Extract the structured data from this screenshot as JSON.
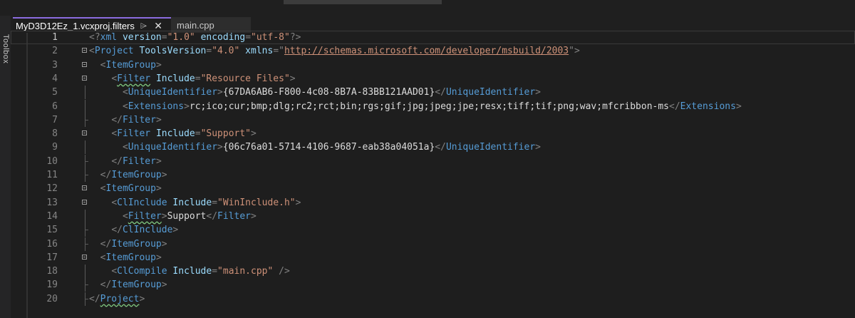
{
  "sidebar": {
    "toolbox_label": "Toolbox"
  },
  "tabs": [
    {
      "label": "MyD3D12Ez_1.vcxproj.filters",
      "active": true
    },
    {
      "label": "main.cpp",
      "active": false
    }
  ],
  "icons": {
    "pin": "pin-icon",
    "close": "close-icon",
    "fold": "collapse-icon"
  },
  "colors": {
    "tag": "#569cd6",
    "attribute": "#9cdcfe",
    "value": "#ce9178",
    "text": "#dcdcdc",
    "punctuation": "#808080",
    "line_number": "#858585",
    "active_tab_accent": "#8b6ce0"
  },
  "editor": {
    "current_line": 1,
    "lines": [
      {
        "n": "1",
        "fold": false,
        "guide": "none",
        "tokens": [
          [
            "punct",
            "<?"
          ],
          [
            "tag",
            "xml"
          ],
          [
            "text",
            " "
          ],
          [
            "attr",
            "version"
          ],
          [
            "punct",
            "="
          ],
          [
            "val",
            "\"1.0\""
          ],
          [
            "text",
            " "
          ],
          [
            "attr",
            "encoding"
          ],
          [
            "punct",
            "="
          ],
          [
            "val",
            "\"utf-8\""
          ],
          [
            "punct",
            "?>"
          ]
        ]
      },
      {
        "n": "2",
        "fold": true,
        "guide": "none",
        "tokens": [
          [
            "punct",
            "<"
          ],
          [
            "tag",
            "Project"
          ],
          [
            "text",
            " "
          ],
          [
            "attr",
            "ToolsVersion"
          ],
          [
            "punct",
            "="
          ],
          [
            "val",
            "\"4.0\""
          ],
          [
            "text",
            " "
          ],
          [
            "attr",
            "xmlns"
          ],
          [
            "punct",
            "="
          ],
          [
            "punct",
            "\""
          ],
          [
            "link",
            "http://schemas.microsoft.com/developer/msbuild/2003"
          ],
          [
            "punct",
            "\">"
          ]
        ]
      },
      {
        "n": "3",
        "fold": true,
        "guide": "none",
        "tokens": [
          [
            "text",
            "  "
          ],
          [
            "punct",
            "<"
          ],
          [
            "tag",
            "ItemGroup"
          ],
          [
            "punct",
            ">"
          ]
        ]
      },
      {
        "n": "4",
        "fold": true,
        "guide": "none",
        "tokens": [
          [
            "text",
            "    "
          ],
          [
            "punct",
            "<"
          ],
          [
            "tagsq",
            "Filter"
          ],
          [
            "text",
            " "
          ],
          [
            "attr",
            "Include"
          ],
          [
            "punct",
            "="
          ],
          [
            "val",
            "\"Resource Files\""
          ],
          [
            "punct",
            ">"
          ]
        ]
      },
      {
        "n": "5",
        "fold": false,
        "guide": "line",
        "tokens": [
          [
            "text",
            "      "
          ],
          [
            "punct",
            "<"
          ],
          [
            "tag",
            "UniqueIdentifier"
          ],
          [
            "punct",
            ">"
          ],
          [
            "text",
            "{67DA6AB6-F800-4c08-8B7A-83BB121AAD01}"
          ],
          [
            "punct",
            "</"
          ],
          [
            "tag",
            "UniqueIdentifier"
          ],
          [
            "punct",
            ">"
          ]
        ]
      },
      {
        "n": "6",
        "fold": false,
        "guide": "line",
        "tokens": [
          [
            "text",
            "      "
          ],
          [
            "punct",
            "<"
          ],
          [
            "tag",
            "Extensions"
          ],
          [
            "punct",
            ">"
          ],
          [
            "text",
            "rc;ico;cur;bmp;dlg;rc2;rct;bin;rgs;gif;jpg;jpeg;jpe;resx;tiff;tif;png;wav;mfcribbon-ms"
          ],
          [
            "punct",
            "</"
          ],
          [
            "tag",
            "Extensions"
          ],
          [
            "punct",
            ">"
          ]
        ]
      },
      {
        "n": "7",
        "fold": false,
        "guide": "end",
        "tokens": [
          [
            "text",
            "    "
          ],
          [
            "punct",
            "</"
          ],
          [
            "tag",
            "Filter"
          ],
          [
            "punct",
            ">"
          ]
        ]
      },
      {
        "n": "8",
        "fold": true,
        "guide": "none",
        "tokens": [
          [
            "text",
            "    "
          ],
          [
            "punct",
            "<"
          ],
          [
            "tag",
            "Filter"
          ],
          [
            "text",
            " "
          ],
          [
            "attr",
            "Include"
          ],
          [
            "punct",
            "="
          ],
          [
            "val",
            "\"Support\""
          ],
          [
            "punct",
            ">"
          ]
        ]
      },
      {
        "n": "9",
        "fold": false,
        "guide": "line",
        "tokens": [
          [
            "text",
            "      "
          ],
          [
            "punct",
            "<"
          ],
          [
            "tag",
            "UniqueIdentifier"
          ],
          [
            "punct",
            ">"
          ],
          [
            "text",
            "{06c76a01-5714-4106-9687-eab38a04051a}"
          ],
          [
            "punct",
            "</"
          ],
          [
            "tag",
            "UniqueIdentifier"
          ],
          [
            "punct",
            ">"
          ]
        ]
      },
      {
        "n": "10",
        "fold": false,
        "guide": "end",
        "tokens": [
          [
            "text",
            "    "
          ],
          [
            "punct",
            "</"
          ],
          [
            "tag",
            "Filter"
          ],
          [
            "punct",
            ">"
          ]
        ]
      },
      {
        "n": "11",
        "fold": false,
        "guide": "end",
        "tokens": [
          [
            "text",
            "  "
          ],
          [
            "punct",
            "</"
          ],
          [
            "tag",
            "ItemGroup"
          ],
          [
            "punct",
            ">"
          ]
        ]
      },
      {
        "n": "12",
        "fold": true,
        "guide": "none",
        "tokens": [
          [
            "text",
            "  "
          ],
          [
            "punct",
            "<"
          ],
          [
            "tag",
            "ItemGroup"
          ],
          [
            "punct",
            ">"
          ]
        ]
      },
      {
        "n": "13",
        "fold": true,
        "guide": "none",
        "tokens": [
          [
            "text",
            "    "
          ],
          [
            "punct",
            "<"
          ],
          [
            "tag",
            "ClInclude"
          ],
          [
            "text",
            " "
          ],
          [
            "attr",
            "Include"
          ],
          [
            "punct",
            "="
          ],
          [
            "val",
            "\"WinInclude.h\""
          ],
          [
            "punct",
            ">"
          ]
        ]
      },
      {
        "n": "14",
        "fold": false,
        "guide": "line",
        "tokens": [
          [
            "text",
            "      "
          ],
          [
            "punct",
            "<"
          ],
          [
            "tagsq",
            "Filter"
          ],
          [
            "punct",
            ">"
          ],
          [
            "text",
            "Support"
          ],
          [
            "punct",
            "</"
          ],
          [
            "tag",
            "Filter"
          ],
          [
            "punct",
            ">"
          ]
        ]
      },
      {
        "n": "15",
        "fold": false,
        "guide": "end",
        "tokens": [
          [
            "text",
            "    "
          ],
          [
            "punct",
            "</"
          ],
          [
            "tag",
            "ClInclude"
          ],
          [
            "punct",
            ">"
          ]
        ]
      },
      {
        "n": "16",
        "fold": false,
        "guide": "end",
        "tokens": [
          [
            "text",
            "  "
          ],
          [
            "punct",
            "</"
          ],
          [
            "tag",
            "ItemGroup"
          ],
          [
            "punct",
            ">"
          ]
        ]
      },
      {
        "n": "17",
        "fold": true,
        "guide": "none",
        "tokens": [
          [
            "text",
            "  "
          ],
          [
            "punct",
            "<"
          ],
          [
            "tag",
            "ItemGroup"
          ],
          [
            "punct",
            ">"
          ]
        ]
      },
      {
        "n": "18",
        "fold": false,
        "guide": "line",
        "tokens": [
          [
            "text",
            "    "
          ],
          [
            "punct",
            "<"
          ],
          [
            "tag",
            "ClCompile"
          ],
          [
            "text",
            " "
          ],
          [
            "attr",
            "Include"
          ],
          [
            "punct",
            "="
          ],
          [
            "val",
            "\"main.cpp\""
          ],
          [
            "text",
            " "
          ],
          [
            "punct",
            "/>"
          ]
        ]
      },
      {
        "n": "19",
        "fold": false,
        "guide": "end",
        "tokens": [
          [
            "text",
            "  "
          ],
          [
            "punct",
            "</"
          ],
          [
            "tag",
            "ItemGroup"
          ],
          [
            "punct",
            ">"
          ]
        ]
      },
      {
        "n": "20",
        "fold": false,
        "guide": "end",
        "tokens": [
          [
            "punct",
            "</"
          ],
          [
            "tagsq",
            "Project"
          ],
          [
            "punct",
            ">"
          ]
        ]
      }
    ]
  }
}
